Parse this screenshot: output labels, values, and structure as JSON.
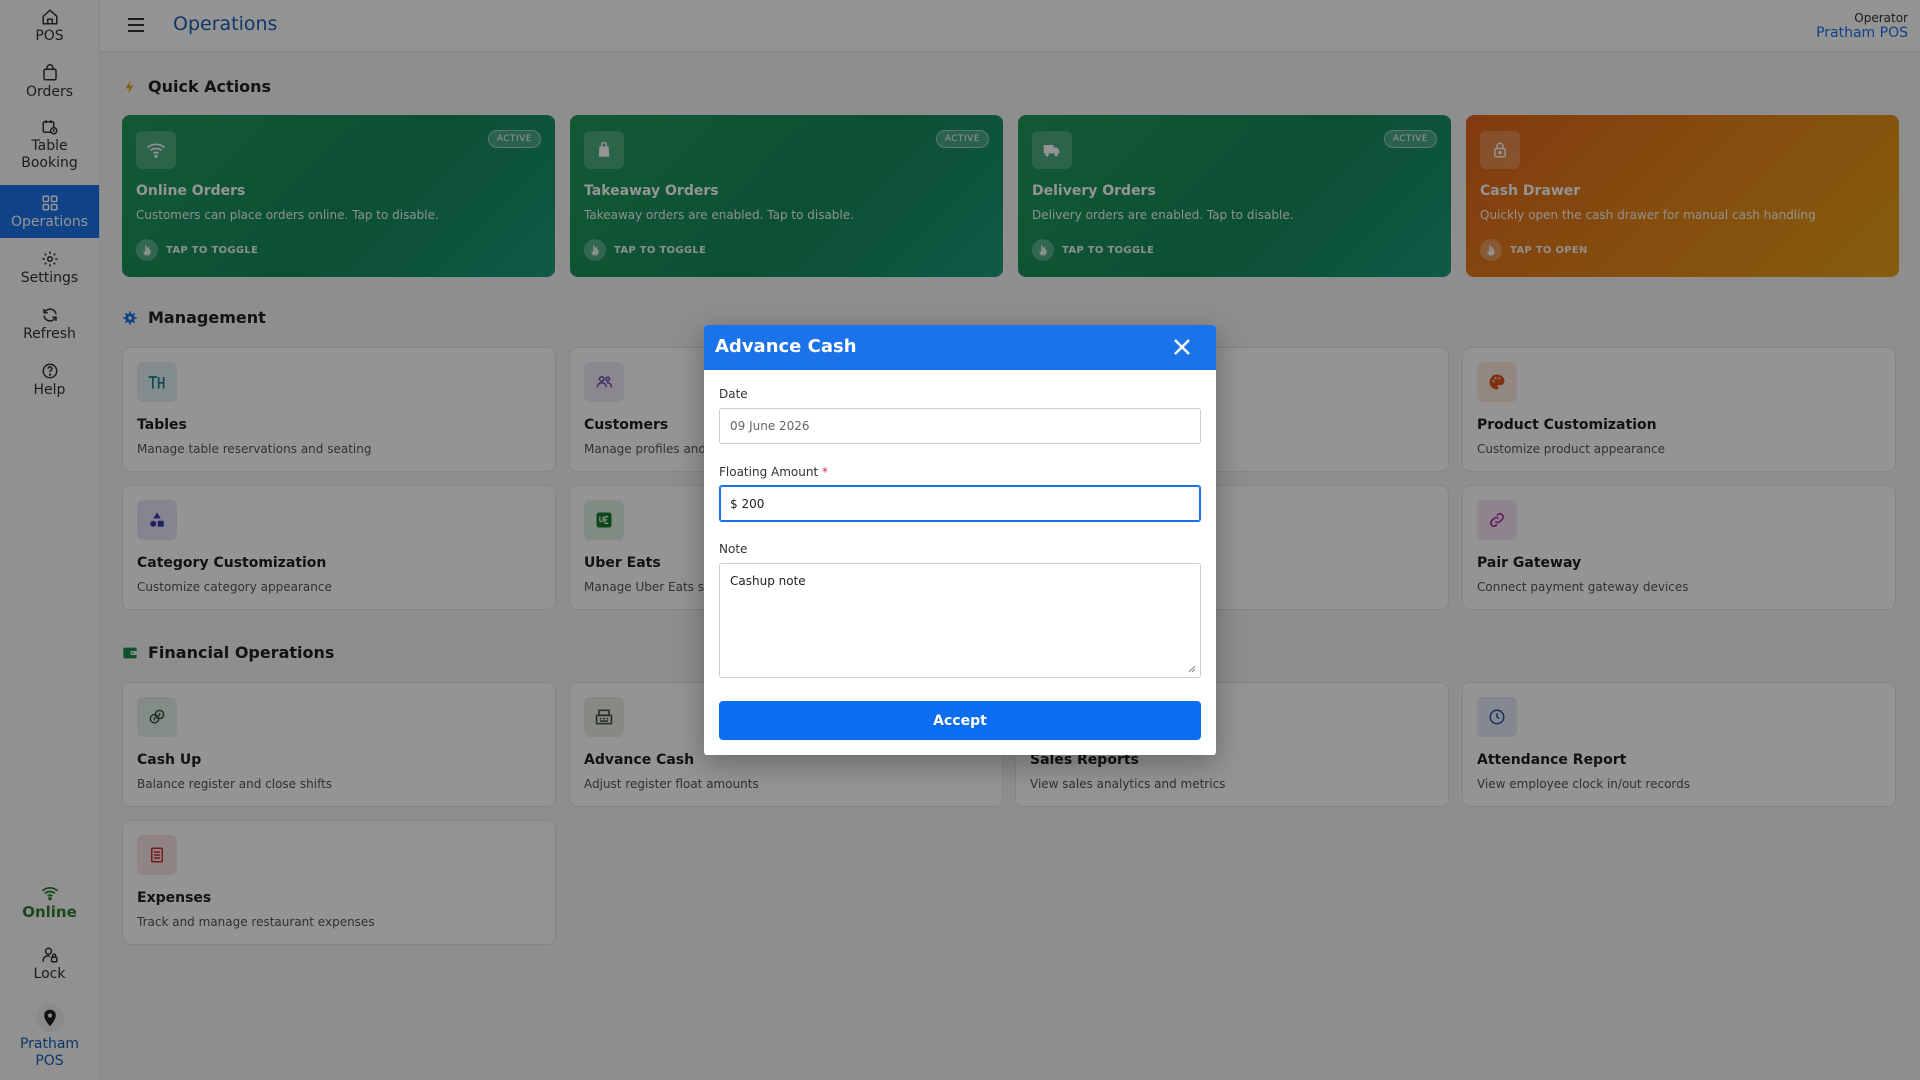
{
  "sidebar": {
    "items": [
      {
        "label": "POS"
      },
      {
        "label": "Orders"
      },
      {
        "label": "Table Booking"
      },
      {
        "label": "Operations"
      },
      {
        "label": "Settings"
      },
      {
        "label": "Refresh"
      },
      {
        "label": "Help"
      }
    ],
    "status_label": "Online",
    "lock_label": "Lock",
    "brand_label": "Pratham POS"
  },
  "header": {
    "title": "Operations",
    "operator_label": "Operator",
    "operator_name": "Pratham POS"
  },
  "quick_actions": {
    "title": "Quick Actions",
    "cards": [
      {
        "title": "Online Orders",
        "desc": "Customers can place orders online. Tap to disable.",
        "badge": "ACTIVE",
        "action": "TAP TO TOGGLE"
      },
      {
        "title": "Takeaway Orders",
        "desc": "Takeaway orders are enabled. Tap to disable.",
        "badge": "ACTIVE",
        "action": "TAP TO TOGGLE"
      },
      {
        "title": "Delivery Orders",
        "desc": "Delivery orders are enabled. Tap to disable.",
        "badge": "ACTIVE",
        "action": "TAP TO TOGGLE"
      },
      {
        "title": "Cash Drawer",
        "desc": "Quickly open the cash drawer for manual cash handling",
        "action": "TAP TO OPEN"
      }
    ]
  },
  "management": {
    "title": "Management",
    "cards": [
      {
        "title": "Tables",
        "desc": "Manage table reservations and seating"
      },
      {
        "title": "Customers",
        "desc": "Manage profiles and o"
      },
      {
        "title": "Product Customization",
        "desc": "Customize product appearance"
      },
      {
        "title": "Category Customization",
        "desc": "Customize category appearance"
      },
      {
        "title": "Uber Eats",
        "desc": "Manage Uber Eats sto"
      },
      {
        "title": "Pair Gateway",
        "desc": "Connect payment gateway devices"
      }
    ]
  },
  "financial": {
    "title": "Financial Operations",
    "cards": [
      {
        "title": "Cash Up",
        "desc": "Balance register and close shifts"
      },
      {
        "title": "Advance Cash",
        "desc": "Adjust register float amounts"
      },
      {
        "title": "Sales Reports",
        "desc": "View sales analytics and metrics"
      },
      {
        "title": "Attendance Report",
        "desc": "View employee clock in/out records"
      },
      {
        "title": "Expenses",
        "desc": "Track and manage restaurant expenses"
      }
    ]
  },
  "modal": {
    "title": "Advance Cash",
    "date_label": "Date",
    "date_value": "09 June 2026",
    "amount_label": "Floating Amount",
    "amount_required_mark": "*",
    "amount_prefix": "$",
    "amount_value": "200",
    "note_label": "Note",
    "note_value": "Cashup note",
    "accept_label": "Accept"
  },
  "colors": {
    "primary": "#1a73e8",
    "active_card": "#1e9b5a",
    "cash_drawer_card": "#e6891a",
    "online_status": "#2e7d32"
  }
}
